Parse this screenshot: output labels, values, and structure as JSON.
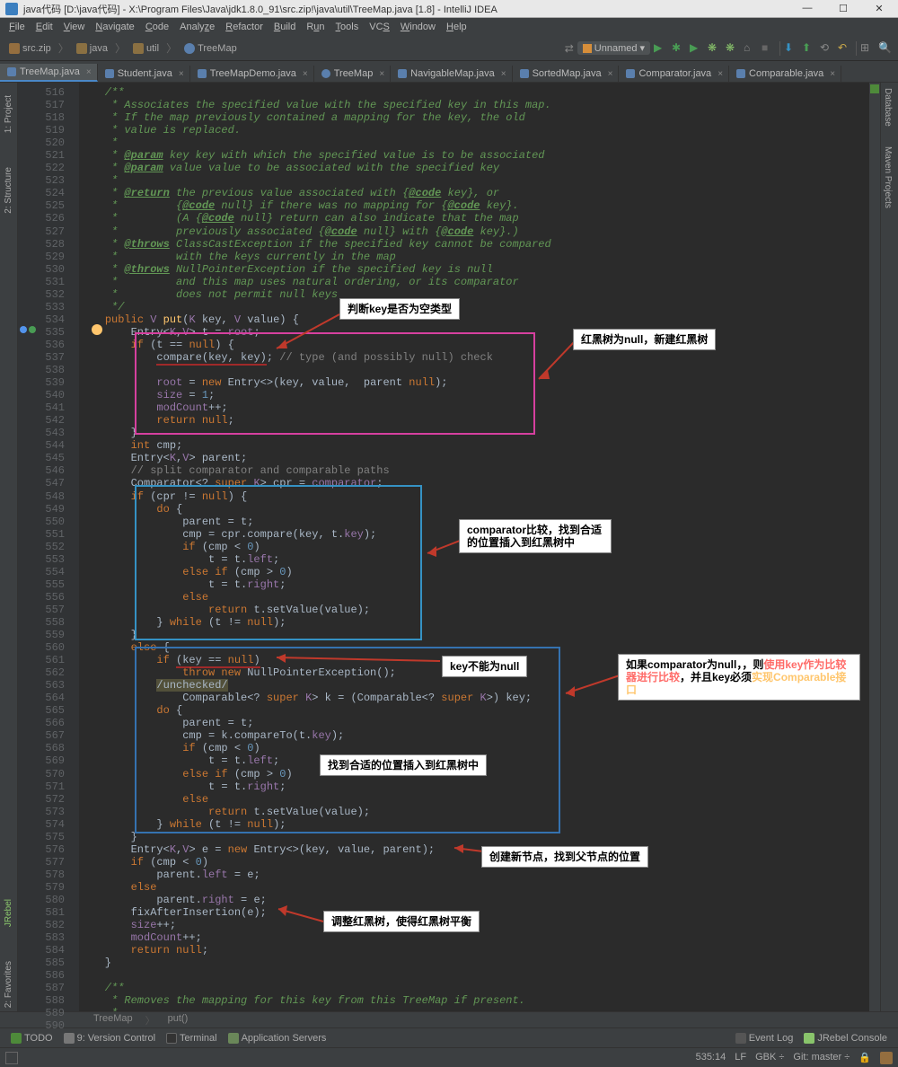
{
  "title": "java代码 [D:\\java代码] - X:\\Program Files\\Java\\jdk1.8.0_91\\src.zip!\\java\\util\\TreeMap.java [1.8] - IntelliJ IDEA",
  "menu": [
    "File",
    "Edit",
    "View",
    "Navigate",
    "Code",
    "Analyze",
    "Refactor",
    "Build",
    "Run",
    "Tools",
    "VCS",
    "Window",
    "Help"
  ],
  "crumbs": [
    {
      "icon": "archive",
      "label": "src.zip"
    },
    {
      "icon": "folder",
      "label": "java"
    },
    {
      "icon": "folder",
      "label": "util"
    },
    {
      "icon": "class",
      "label": "TreeMap"
    }
  ],
  "runcfg": "Unnamed",
  "tabs": [
    {
      "label": "TreeMap.java",
      "active": true
    },
    {
      "label": "Student.java"
    },
    {
      "label": "TreeMapDemo.java"
    },
    {
      "label": "TreeMap"
    },
    {
      "label": "NavigableMap.java"
    },
    {
      "label": "SortedMap.java"
    },
    {
      "label": "Comparator.java"
    },
    {
      "label": "Comparable.java"
    }
  ],
  "sidetabs_left": [
    "1: Project",
    "2: Structure"
  ],
  "sidetabs_right": [
    "Database",
    "Maven Projects"
  ],
  "lines_start": 516,
  "lines_end": 590,
  "annotations": {
    "a1": "判断key是否为空类型",
    "a2": "红黑树为null，新建红黑树",
    "a3": "comparator比较，找到合适的位置插入到红黑树中",
    "a4": "key不能为null",
    "a5p1": "如果comparator为null，，则",
    "a5p2": "使用key作为比较器进行比较",
    "a5p3": "，并且key必须",
    "a5p4": "实现Comparable接口",
    "a6": "找到合适的位置插入到红黑树中",
    "a7": "创建新节点，找到父节点的位置",
    "a8": "调整红黑树，使得红黑树平衡"
  },
  "breadcrumb": [
    "TreeMap",
    "put()"
  ],
  "bottom_tools": [
    "TODO",
    "9: Version Control",
    "Terminal",
    "Application Servers"
  ],
  "bottom_right": [
    "Event Log",
    "JRebel Console"
  ],
  "status": {
    "pos": "535:14",
    "lf": "LF",
    "enc": "GBK",
    "git": "Git: master",
    "lock": "🔒"
  }
}
